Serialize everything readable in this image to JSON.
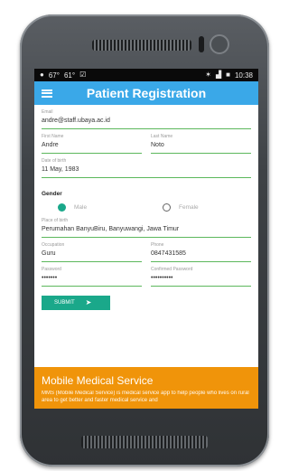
{
  "status_bar": {
    "left_items": [
      "67°",
      "61°"
    ],
    "time": "10:38",
    "icons": [
      "whatsapp-icon",
      "image-icon",
      "checkbox-icon",
      "bluetooth-icon",
      "signal-icon",
      "battery-icon"
    ]
  },
  "app_bar": {
    "title": "Patient Registration",
    "menu_icon": "hamburger-menu-icon",
    "color": "#3aa8e8"
  },
  "form": {
    "email": {
      "label": "Email",
      "value": "andre@staff.ubaya.ac.id"
    },
    "first_name": {
      "label": "First Name",
      "value": "Andre"
    },
    "last_name": {
      "label": "Last Name",
      "value": "Noto"
    },
    "dob": {
      "label": "Date of birth",
      "value": "11 May, 1983"
    },
    "gender": {
      "title": "Gender",
      "options": [
        "Male",
        "Female"
      ],
      "selected": "Male"
    },
    "place_of_birth": {
      "label": "Place of birth",
      "value": "Perumahan BanyuBiru, Banyuwangi, Jawa Timur"
    },
    "occupation": {
      "label": "Occupation",
      "value": "Guru"
    },
    "phone": {
      "label": "Phone",
      "value": "0847431585"
    },
    "password": {
      "label": "Password",
      "value": "•••••••"
    },
    "confirm_password": {
      "label": "Confirmed Password",
      "value": "••••••••••"
    },
    "submit_label": "SUBMIT",
    "accent": "#5cb85c",
    "button_color": "#1aa88a"
  },
  "banner": {
    "title": "Mobile Medical Service",
    "description": "MMS (Mobile Medical Service) is medical service app to help people who lives on rural area to get better and faster medical service and",
    "color": "#f0940a"
  }
}
